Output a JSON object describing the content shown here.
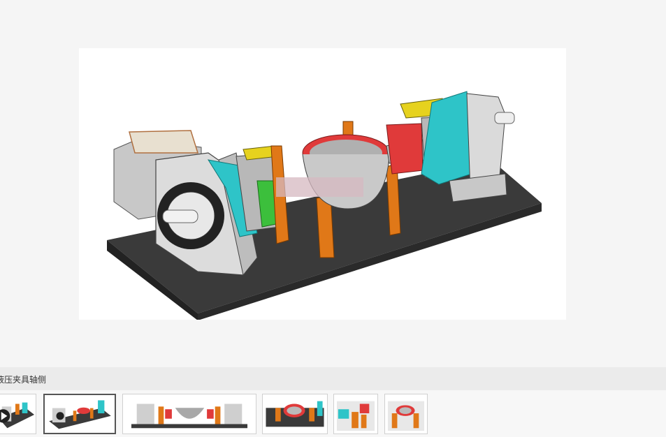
{
  "viewer": {
    "main_image": "hydraulic-fixture-axonometric-render"
  },
  "caption": {
    "text": "液压夹具轴侧"
  },
  "thumbnails": [
    {
      "name": "video-thumbnail",
      "selected": false,
      "has_play_icon": true
    },
    {
      "name": "axonometric-view",
      "selected": true
    },
    {
      "name": "front-view",
      "selected": false
    },
    {
      "name": "top-view",
      "selected": false
    },
    {
      "name": "detail-view-1",
      "selected": false
    },
    {
      "name": "detail-view-2",
      "selected": false
    }
  ],
  "colors": {
    "base_plate": "#3a3a3a",
    "fixture_orange": "#e07818",
    "clamp_cyan": "#2ec4c8",
    "housing_red": "#e03a3a",
    "clamp_yellow": "#e6d21e",
    "support_green": "#3cbf3c",
    "body_gray": "#cfcfcf"
  }
}
